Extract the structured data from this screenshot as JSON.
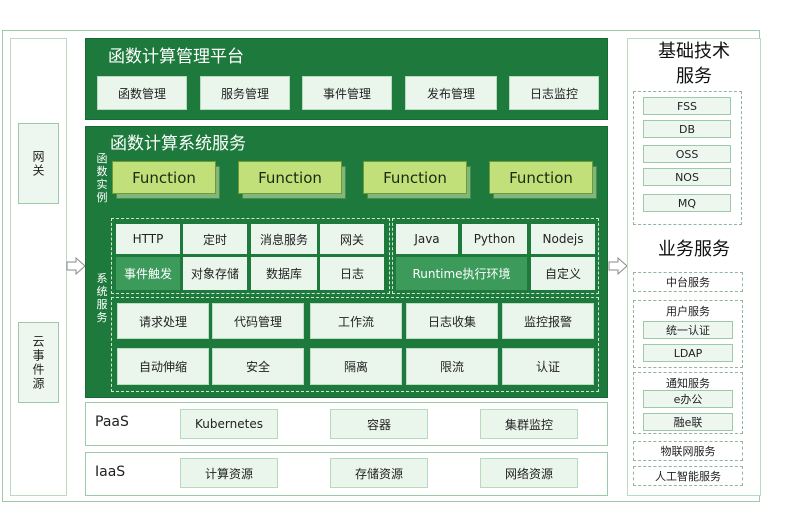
{
  "left": {
    "gateway": "网关",
    "cloud_event_source": "云事件源"
  },
  "platform": {
    "title": "函数计算管理平台",
    "buttons": [
      "函数管理",
      "服务管理",
      "事件管理",
      "发布管理",
      "日志监控"
    ]
  },
  "service": {
    "title": "函数计算系统服务",
    "instances_label": "函数实例",
    "system_label": "系统服务",
    "functions": [
      "Function",
      "Function",
      "Function",
      "Function"
    ],
    "grid1": {
      "row1": [
        "HTTP",
        "定时",
        "消息服务",
        "网关"
      ],
      "row2": [
        "事件触发",
        "对象存储",
        "数据库",
        "日志"
      ]
    },
    "grid2": {
      "row1": [
        "Java",
        "Python",
        "Nodejs"
      ],
      "runtime": "Runtime执行环境",
      "custom": "自定义"
    },
    "grid3": {
      "row1": [
        "请求处理",
        "代码管理",
        "工作流",
        "日志收集",
        "监控报警"
      ],
      "row2": [
        "自动伸缩",
        "安全",
        "隔离",
        "限流",
        "认证"
      ]
    }
  },
  "paas": {
    "title": "PaaS",
    "items": [
      "Kubernetes",
      "容器",
      "集群监控"
    ]
  },
  "iaas": {
    "title": "IaaS",
    "items": [
      "计算资源",
      "存储资源",
      "网络资源"
    ]
  },
  "right": {
    "basic_title_1": "基础技术",
    "basic_title_2": "服务",
    "basic_items": [
      "FSS",
      "DB",
      "OSS",
      "NOS",
      "MQ"
    ],
    "business_title": "业务服务",
    "zhongtai": "中台服务",
    "user_service": "用户服务",
    "user_items": [
      "统一认证",
      "LDAP"
    ],
    "notify_service": "通知服务",
    "notify_items": [
      "e办公",
      "融e联"
    ],
    "iot": "物联网服务",
    "ai": "人工智能服务"
  }
}
